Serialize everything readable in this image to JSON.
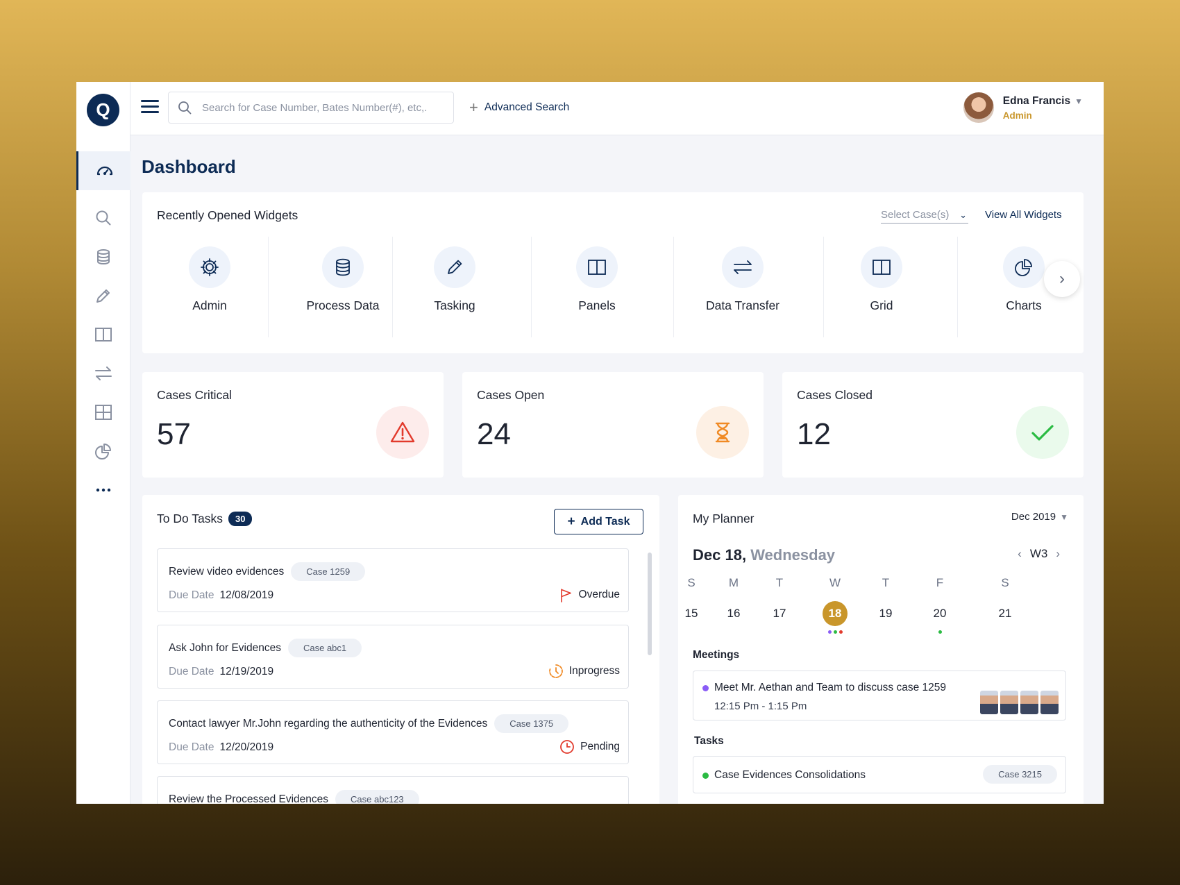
{
  "app": {
    "logo_letter": "Q"
  },
  "header": {
    "search_placeholder": "Search for Case Number, Bates Number(#), etc,.",
    "advanced_search": "Advanced Search",
    "user_name": "Edna Francis",
    "user_role": "Admin"
  },
  "sidebar": {
    "items": [
      {
        "icon": "dashboard-icon",
        "active": true
      },
      {
        "icon": "search-icon"
      },
      {
        "icon": "database-icon"
      },
      {
        "icon": "pencil-icon"
      },
      {
        "icon": "panels-icon"
      },
      {
        "icon": "transfer-icon"
      },
      {
        "icon": "grid-icon"
      },
      {
        "icon": "pie-chart-icon"
      },
      {
        "icon": "more-icon"
      }
    ]
  },
  "page": {
    "title": "Dashboard"
  },
  "widgets": {
    "title": "Recently Opened Widgets",
    "select_label": "Select Case(s)",
    "view_all": "View All Widgets",
    "items": [
      {
        "label": "Admin",
        "icon": "gear-icon"
      },
      {
        "label": "Process Data",
        "icon": "database-icon"
      },
      {
        "label": "Tasking",
        "icon": "pencil-icon"
      },
      {
        "label": "Panels",
        "icon": "panels-icon"
      },
      {
        "label": "Data Transfer",
        "icon": "transfer-icon"
      },
      {
        "label": "Grid",
        "icon": "panels-icon"
      },
      {
        "label": "Charts",
        "icon": "pie-chart-icon"
      }
    ]
  },
  "stats": [
    {
      "title": "Cases Critical",
      "value": "57",
      "icon": "warning-icon",
      "color": "#e23a2c",
      "bg": "#fdeceb"
    },
    {
      "title": "Cases Open",
      "value": "24",
      "icon": "hourglass-icon",
      "color": "#f08a24",
      "bg": "#fdf0e4"
    },
    {
      "title": "Cases Closed",
      "value": "12",
      "icon": "check-icon",
      "color": "#2bbb43",
      "bg": "#eafaec"
    }
  ],
  "tasks": {
    "title": "To Do Tasks",
    "count": "30",
    "add_label": "Add Task",
    "due_label": "Due Date",
    "items": [
      {
        "name": "Review video evidences",
        "case": "Case 1259",
        "due": "12/08/2019",
        "status": "Overdue",
        "status_icon": "flag-icon"
      },
      {
        "name": "Ask John for Evidences",
        "case": "Case abc1",
        "due": "12/19/2019",
        "status": "Inprogress",
        "status_icon": "progress-clock-icon"
      },
      {
        "name": "Contact lawyer Mr.John regarding the authenticity of the Evidences",
        "case": "Case 1375",
        "due": "12/20/2019",
        "status": "Pending",
        "status_icon": "clock-icon"
      },
      {
        "name": "Review the Processed Evidences",
        "case": "Case abc123",
        "due": "",
        "status": "",
        "status_icon": ""
      }
    ]
  },
  "planner": {
    "title": "My Planner",
    "month": "Dec 2019",
    "date": "Dec 18,",
    "weekday": "Wednesday",
    "week": "W3",
    "days": [
      {
        "name": "S",
        "num": "15"
      },
      {
        "name": "M",
        "num": "16"
      },
      {
        "name": "T",
        "num": "17"
      },
      {
        "name": "W",
        "num": "18",
        "today": true
      },
      {
        "name": "T",
        "num": "19"
      },
      {
        "name": "F",
        "num": "20"
      },
      {
        "name": "S",
        "num": "21"
      }
    ],
    "meetings_label": "Meetings",
    "meeting": {
      "title": "Meet Mr. Aethan and Team to discuss case 1259",
      "time": "12:15 Pm - 1:15 Pm"
    },
    "tasks_label": "Tasks",
    "task": {
      "title": "Case Evidences Consolidations",
      "case": "Case 3215"
    }
  }
}
